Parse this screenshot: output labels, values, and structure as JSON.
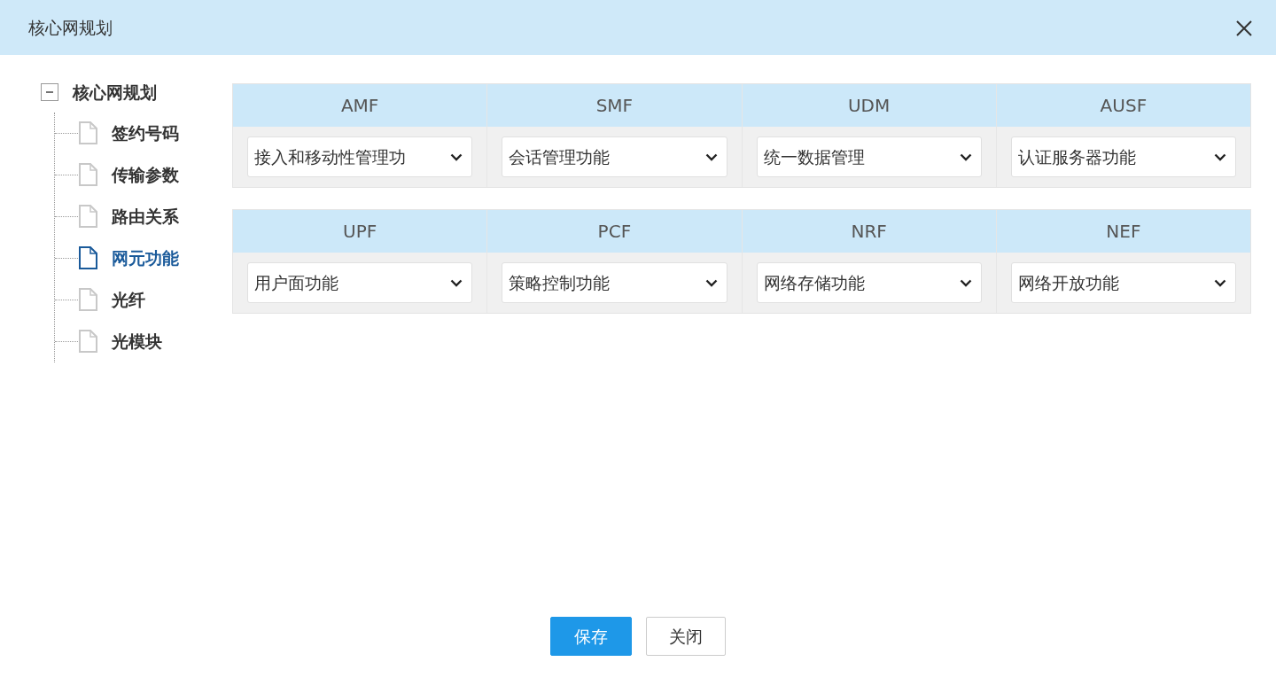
{
  "window": {
    "title": "核心网规划"
  },
  "tree": {
    "label": "核心网规划",
    "expanded": true,
    "children": [
      {
        "label": "签约号码",
        "selected": false
      },
      {
        "label": "传输参数",
        "selected": false
      },
      {
        "label": "路由关系",
        "selected": false
      },
      {
        "label": "网元功能",
        "selected": true
      },
      {
        "label": "光纤",
        "selected": false
      },
      {
        "label": "光模块",
        "selected": false
      }
    ]
  },
  "groups": [
    {
      "cells": [
        {
          "heading": "AMF",
          "value": "接入和移动性管理功"
        },
        {
          "heading": "SMF",
          "value": "会话管理功能"
        },
        {
          "heading": "UDM",
          "value": "统一数据管理"
        },
        {
          "heading": "AUSF",
          "value": "认证服务器功能"
        }
      ]
    },
    {
      "cells": [
        {
          "heading": "UPF",
          "value": "用户面功能"
        },
        {
          "heading": "PCF",
          "value": "策略控制功能"
        },
        {
          "heading": "NRF",
          "value": "网络存储功能"
        },
        {
          "heading": "NEF",
          "value": "网络开放功能"
        }
      ]
    }
  ],
  "buttons": [
    {
      "label": "保存",
      "kind": "primary"
    },
    {
      "label": "关闭",
      "kind": "secondary"
    }
  ]
}
